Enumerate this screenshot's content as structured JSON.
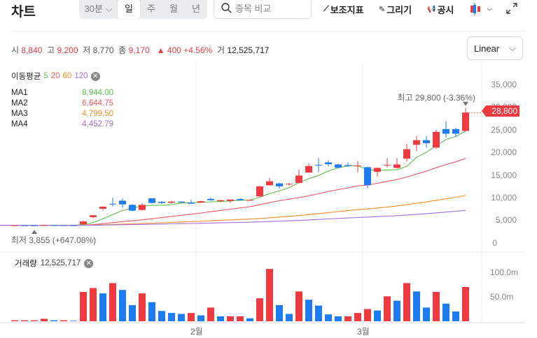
{
  "header": {
    "title": "차트",
    "intervals": [
      {
        "label": "30분",
        "dropdown": true
      },
      {
        "label": "일",
        "selected": true
      },
      {
        "label": "주"
      },
      {
        "label": "월"
      },
      {
        "label": "년"
      }
    ],
    "search_placeholder": "종목 비교",
    "tools": {
      "indicators": "보조지표",
      "draw": "그리기",
      "disclosure": "공시"
    }
  },
  "info": {
    "open_label": "시",
    "open": "8,840",
    "high_label": "고",
    "high": "9,200",
    "low_label": "저",
    "low": "8,770",
    "close_label": "종",
    "close": "9,170",
    "change": "▲ 400 +4.56%",
    "volume_label": "거",
    "volume": "12,525,717"
  },
  "scale_select": "Linear",
  "ma_legend": {
    "title": "이동평균",
    "periods": [
      "5",
      "20",
      "60",
      "120"
    ],
    "rows": [
      {
        "name": "MA1",
        "value": "8,944.00"
      },
      {
        "name": "MA2",
        "value": "6,644.75"
      },
      {
        "name": "MA3",
        "value": "4,799.50"
      },
      {
        "name": "MA4",
        "value": "4,452.79"
      }
    ]
  },
  "colors": {
    "up": "#ef3b3f",
    "down": "#1e7cf2",
    "ma": [
      "#5cc14a",
      "#f5575c",
      "#ff8f26",
      "#a56ee0"
    ],
    "grid": "#eceef0"
  },
  "price_axis": {
    "ticks": [
      "35,000",
      "30,000",
      "25,000",
      "20,000",
      "15,000",
      "10,000",
      "5,000",
      "0"
    ],
    "current": "28,800"
  },
  "high_marker": "최고  29,800 (-3.36%)",
  "low_marker": "최저  3,855 (+647.08%)",
  "volume_panel": {
    "title": "거래량",
    "value": "12,525,717",
    "ticks": [
      "100.0m",
      "50.0m"
    ]
  },
  "x_axis": {
    "labels": [
      {
        "label": "2월",
        "index": 18.5
      },
      {
        "label": "3月",
        "index": 35.5
      }
    ]
  },
  "chart_data": {
    "type": "candlestick",
    "ylim": [
      0,
      35000
    ],
    "volume_ylim": [
      0,
      130
    ],
    "volume_unit": "m",
    "ma_periods": [
      5,
      20,
      60,
      120
    ],
    "ohlc": [
      [
        3900,
        3950,
        3880,
        3910
      ],
      [
        3910,
        3940,
        3870,
        3900
      ],
      [
        3900,
        3920,
        3855,
        3890
      ],
      [
        3890,
        3960,
        3880,
        3940
      ],
      [
        3940,
        3960,
        3900,
        3920
      ],
      [
        3920,
        3940,
        3890,
        3910
      ],
      [
        3910,
        3930,
        3890,
        3900
      ],
      [
        4140,
        4900,
        4100,
        4760
      ],
      [
        5720,
        6200,
        5470,
        6130
      ],
      [
        7560,
        8100,
        7150,
        8020
      ],
      [
        8680,
        10010,
        8070,
        8580
      ],
      [
        9350,
        9860,
        7820,
        8530
      ],
      [
        8430,
        8580,
        7000,
        7150
      ],
      [
        7300,
        8780,
        7250,
        8430
      ],
      [
        9860,
        9960,
        8700,
        8840
      ],
      [
        9090,
        9250,
        8630,
        8840
      ],
      [
        8890,
        9300,
        8680,
        9140
      ],
      [
        9140,
        9250,
        8900,
        8940
      ],
      [
        8940,
        9600,
        8700,
        8680
      ],
      [
        8940,
        9300,
        8840,
        9240
      ],
      [
        9750,
        10060,
        9350,
        9450
      ],
      [
        9240,
        9550,
        9040,
        9450
      ],
      [
        9300,
        9600,
        8840,
        9600
      ],
      [
        9700,
        9860,
        9350,
        9450
      ],
      [
        9500,
        9600,
        9300,
        9500
      ],
      [
        10310,
        12610,
        10210,
        12510
      ],
      [
        12760,
        14390,
        12660,
        13630
      ],
      [
        13170,
        13270,
        12000,
        12510
      ],
      [
        12920,
        13320,
        12660,
        13070
      ],
      [
        13270,
        16230,
        13170,
        14900
      ],
      [
        15570,
        17610,
        15470,
        17000
      ],
      [
        17250,
        18730,
        15670,
        17100
      ],
      [
        17810,
        18270,
        16900,
        17400
      ],
      [
        17350,
        17500,
        16590,
        16640
      ],
      [
        17200,
        17810,
        16790,
        17000
      ],
      [
        16940,
        18120,
        15570,
        17100
      ],
      [
        16740,
        16840,
        12150,
        12760
      ],
      [
        15720,
        16690,
        14650,
        16590
      ],
      [
        17100,
        18730,
        16690,
        17250
      ],
      [
        16590,
        18730,
        16490,
        17350
      ],
      [
        18630,
        21890,
        18020,
        20720
      ],
      [
        21690,
        23630,
        20260,
        22710
      ],
      [
        22710,
        23630,
        21080,
        22040
      ],
      [
        21080,
        25000,
        20770,
        24540
      ],
      [
        25160,
        26890,
        23220,
        24140
      ],
      [
        25160,
        25460,
        23420,
        24140
      ],
      [
        24750,
        29800,
        24650,
        28800
      ]
    ],
    "volume": [
      2,
      2,
      2,
      5,
      2,
      2,
      1,
      60,
      68,
      57,
      78,
      64,
      33,
      57,
      39,
      21,
      17,
      15,
      17,
      12,
      28,
      10,
      10,
      10,
      6,
      47,
      107,
      33,
      15,
      61,
      44,
      32,
      14,
      10,
      10,
      17,
      25,
      22,
      51,
      42,
      78,
      61,
      28,
      60,
      36,
      20,
      70
    ]
  }
}
